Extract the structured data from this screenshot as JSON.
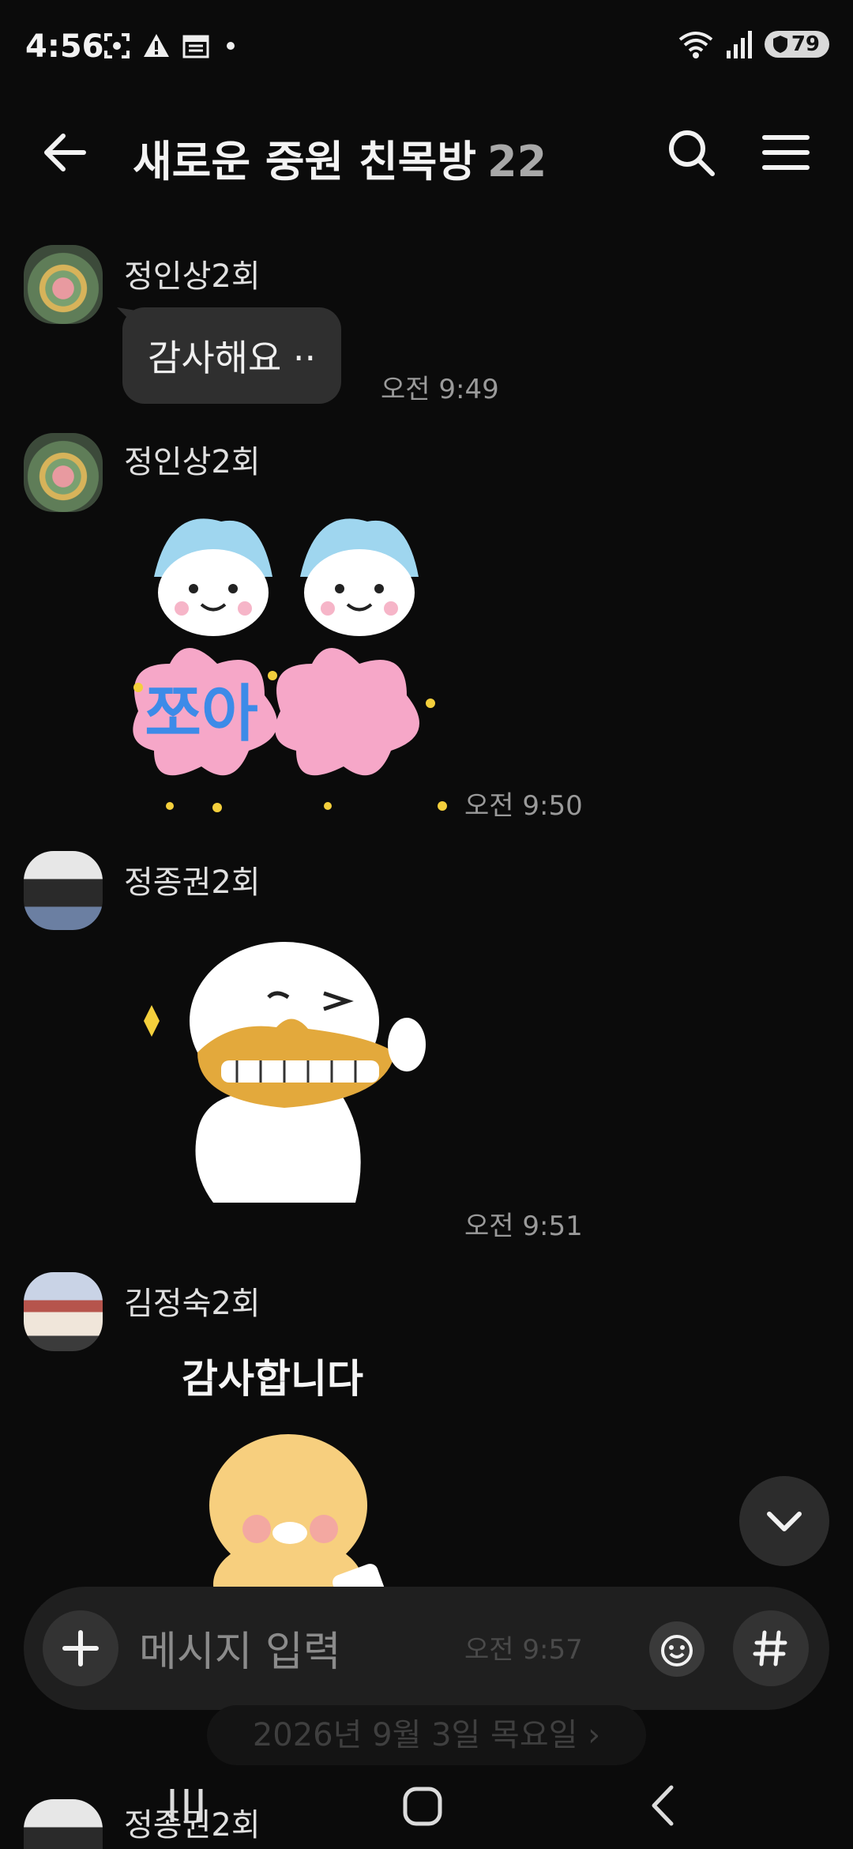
{
  "status_bar": {
    "time": "4:56",
    "battery": "79"
  },
  "header": {
    "title": "새로운 중원 친목방",
    "member_count": "22"
  },
  "messages": [
    {
      "sender": "정인상2회",
      "text": "감사해요 ··",
      "time": "오전 9:49"
    },
    {
      "sender": "정인상2회",
      "sticker_text": "쪼아",
      "time": "오전 9:50"
    },
    {
      "sender": "정종권2회",
      "time": "오전 9:51"
    },
    {
      "sender": "김정숙2회",
      "sticker_text": "감사합니다",
      "time": "오전 9:57"
    },
    {
      "sender": "정종권2회"
    }
  ],
  "input": {
    "placeholder": "메시지 입력"
  },
  "date_divider": "2026년 9월 3일 목요일 ›",
  "icons": {
    "back": "arrow-left-icon",
    "search": "search-icon",
    "menu": "hamburger-menu-icon",
    "plus": "plus-icon",
    "emoji": "emoji-icon",
    "hashtag": "hashtag-icon",
    "scroll_down": "chevron-down-icon",
    "recents": "recents-icon",
    "home": "home-icon",
    "nav_back": "nav-back-icon"
  }
}
